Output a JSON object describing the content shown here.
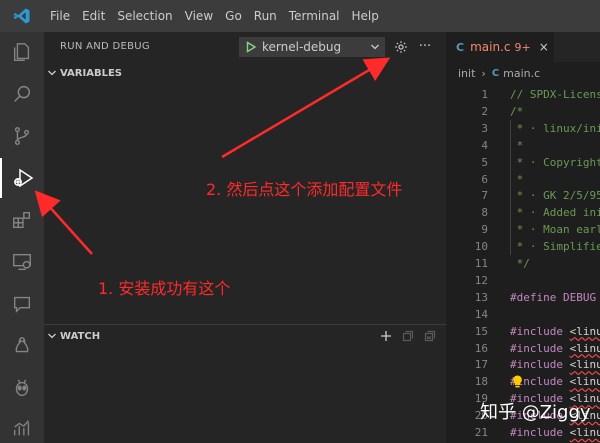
{
  "menu": {
    "items": [
      "File",
      "Edit",
      "Selection",
      "View",
      "Go",
      "Run",
      "Terminal",
      "Help"
    ]
  },
  "activity_bar": {
    "icons": [
      "explorer-icon",
      "search-icon",
      "source-control-icon",
      "run-debug-icon",
      "extensions-icon",
      "remote-explorer-icon",
      "comments-icon",
      "linux-penguin-icon",
      "alien-icon",
      "chart-icon"
    ],
    "active": "run-debug-icon"
  },
  "sidebar": {
    "title": "RUN AND DEBUG",
    "config_name": "kernel-debug",
    "more_label": "···",
    "variables_label": "VARIABLES",
    "watch_label": "WATCH"
  },
  "annotations": {
    "note1": "1. 安装成功有这个",
    "note2": "2. 然后点这个添加配置文件"
  },
  "editor": {
    "tab": {
      "lang": "C",
      "name": "main.c",
      "badge": "9+",
      "close": "×"
    },
    "breadcrumb": {
      "folder": "init",
      "lang": "C",
      "file": "main.c"
    },
    "lines": [
      {
        "n": "1",
        "text": "// SPDX-Licens",
        "kind": "comment"
      },
      {
        "n": "2",
        "text": "/*",
        "kind": "comment"
      },
      {
        "n": "3",
        "text": " * · linux/init",
        "kind": "comment"
      },
      {
        "n": "4",
        "text": " *",
        "kind": "comment"
      },
      {
        "n": "5",
        "text": " * · Copyright",
        "kind": "comment"
      },
      {
        "n": "6",
        "text": " *",
        "kind": "comment"
      },
      {
        "n": "7",
        "text": " * · GK 2/5/95",
        "kind": "comment"
      },
      {
        "n": "8",
        "text": " * · Added init",
        "kind": "comment"
      },
      {
        "n": "9",
        "text": " * · Moan early",
        "kind": "comment"
      },
      {
        "n": "10",
        "text": " * · Simplified",
        "kind": "comment"
      },
      {
        "n": "11",
        "text": " */",
        "kind": "comment"
      },
      {
        "n": "12",
        "text": "",
        "kind": "plain"
      },
      {
        "n": "13",
        "text": "#define DEBUG",
        "kind": "define"
      },
      {
        "n": "14",
        "text": "",
        "kind": "plain"
      },
      {
        "n": "15",
        "text": "#include <linu",
        "kind": "include"
      },
      {
        "n": "16",
        "text": "#include <linu",
        "kind": "include"
      },
      {
        "n": "17",
        "text": "#include <linu",
        "kind": "include"
      },
      {
        "n": "18",
        "text": "#include <linu",
        "kind": "include"
      },
      {
        "n": "19",
        "text": "#include <linu",
        "kind": "include"
      },
      {
        "n": "20",
        "text": "#include <linu",
        "kind": "include"
      },
      {
        "n": "21",
        "text": "#include <linu",
        "kind": "include"
      },
      {
        "n": "22",
        "text": "#include <linu",
        "kind": "include"
      }
    ]
  },
  "watermark": "知乎 @Ziggy",
  "colors": {
    "accent_blue": "#007acc",
    "annotation_red": "#ff2a2a",
    "play_green": "#89d185",
    "comment_green": "#6a9955",
    "directive_purple": "#c586c0"
  }
}
